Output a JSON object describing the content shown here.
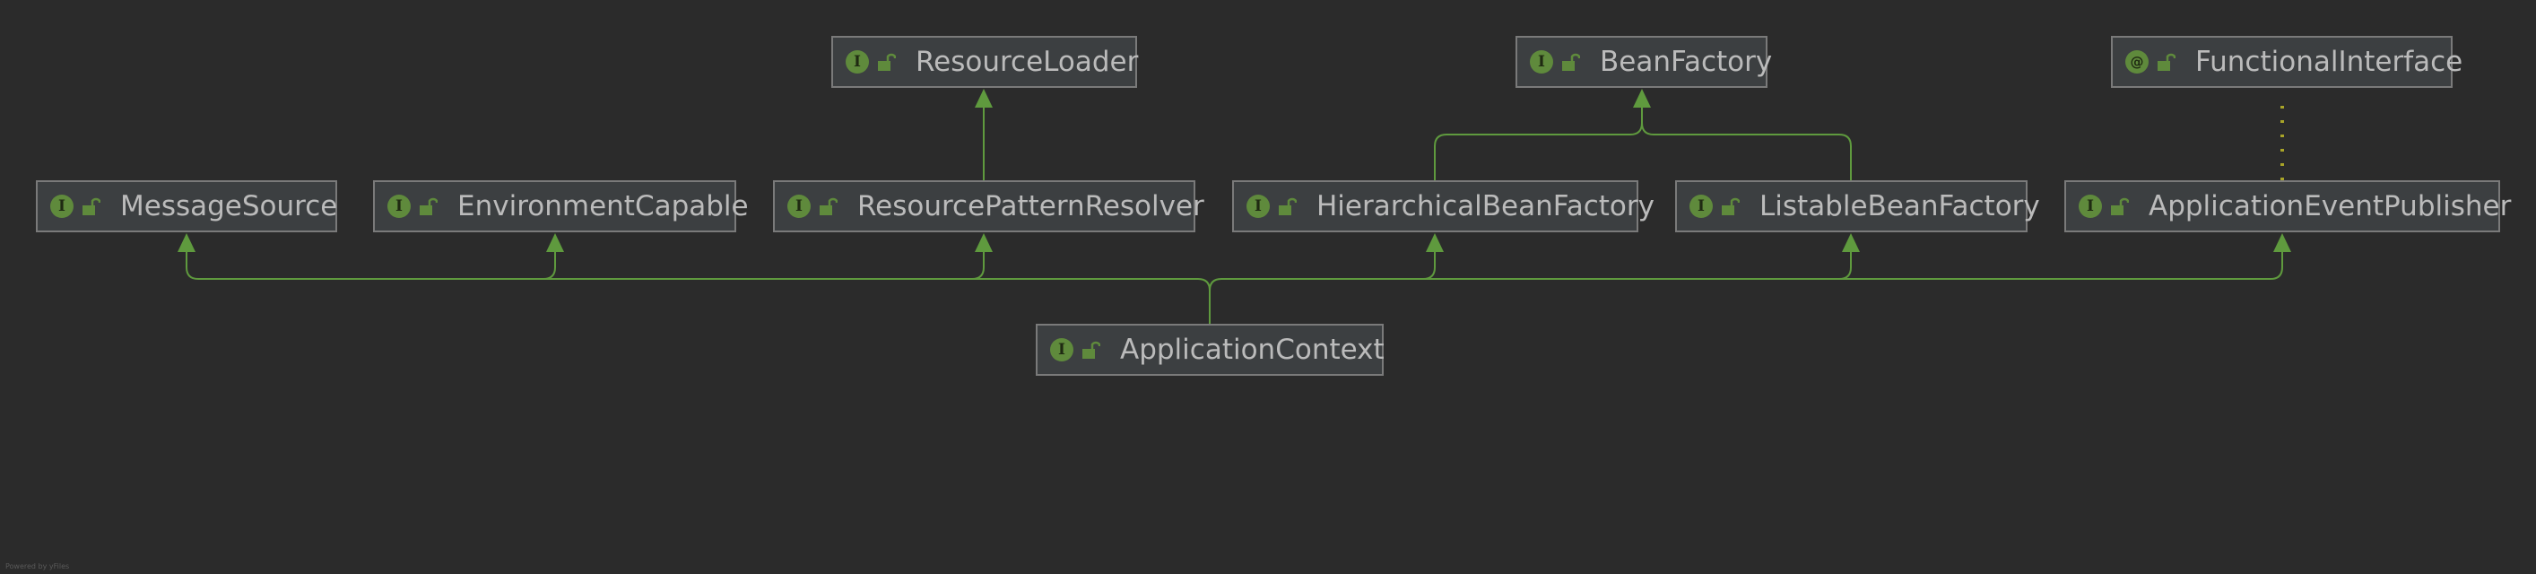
{
  "diagram": {
    "colors": {
      "background": "#2b2b2b",
      "node_fill": "#3c3f41",
      "node_border": "#7a7a7a",
      "text": "#bbbbbb",
      "edge": "#5f9a3e",
      "icon": "#5f8a3c"
    },
    "nodes": [
      {
        "id": "resource-loader",
        "label": "ResourceLoader",
        "kind": "interface",
        "badge": "I"
      },
      {
        "id": "bean-factory",
        "label": "BeanFactory",
        "kind": "interface",
        "badge": "I"
      },
      {
        "id": "functional-interface",
        "label": "FunctionalInterface",
        "kind": "annotation",
        "badge": "@"
      },
      {
        "id": "message-source",
        "label": "MessageSource",
        "kind": "interface",
        "badge": "I"
      },
      {
        "id": "environment-capable",
        "label": "EnvironmentCapable",
        "kind": "interface",
        "badge": "I"
      },
      {
        "id": "resource-pattern-resolver",
        "label": "ResourcePatternResolver",
        "kind": "interface",
        "badge": "I"
      },
      {
        "id": "hierarchical-bean-factory",
        "label": "HierarchicalBeanFactory",
        "kind": "interface",
        "badge": "I"
      },
      {
        "id": "listable-bean-factory",
        "label": "ListableBeanFactory",
        "kind": "interface",
        "badge": "I"
      },
      {
        "id": "application-event-publisher",
        "label": "ApplicationEventPublisher",
        "kind": "interface",
        "badge": "I"
      },
      {
        "id": "application-context",
        "label": "ApplicationContext",
        "kind": "interface",
        "badge": "I"
      }
    ],
    "edges": [
      {
        "from": "resource-pattern-resolver",
        "to": "resource-loader",
        "style": "solid"
      },
      {
        "from": "hierarchical-bean-factory",
        "to": "bean-factory",
        "style": "solid"
      },
      {
        "from": "listable-bean-factory",
        "to": "bean-factory",
        "style": "solid"
      },
      {
        "from": "application-event-publisher",
        "to": "functional-interface",
        "style": "dotted"
      },
      {
        "from": "application-context",
        "to": "message-source",
        "style": "solid"
      },
      {
        "from": "application-context",
        "to": "environment-capable",
        "style": "solid"
      },
      {
        "from": "application-context",
        "to": "resource-pattern-resolver",
        "style": "solid"
      },
      {
        "from": "application-context",
        "to": "hierarchical-bean-factory",
        "style": "solid"
      },
      {
        "from": "application-context",
        "to": "listable-bean-factory",
        "style": "solid"
      },
      {
        "from": "application-context",
        "to": "application-event-publisher",
        "style": "solid"
      }
    ],
    "footer": "Powered by yFiles"
  }
}
